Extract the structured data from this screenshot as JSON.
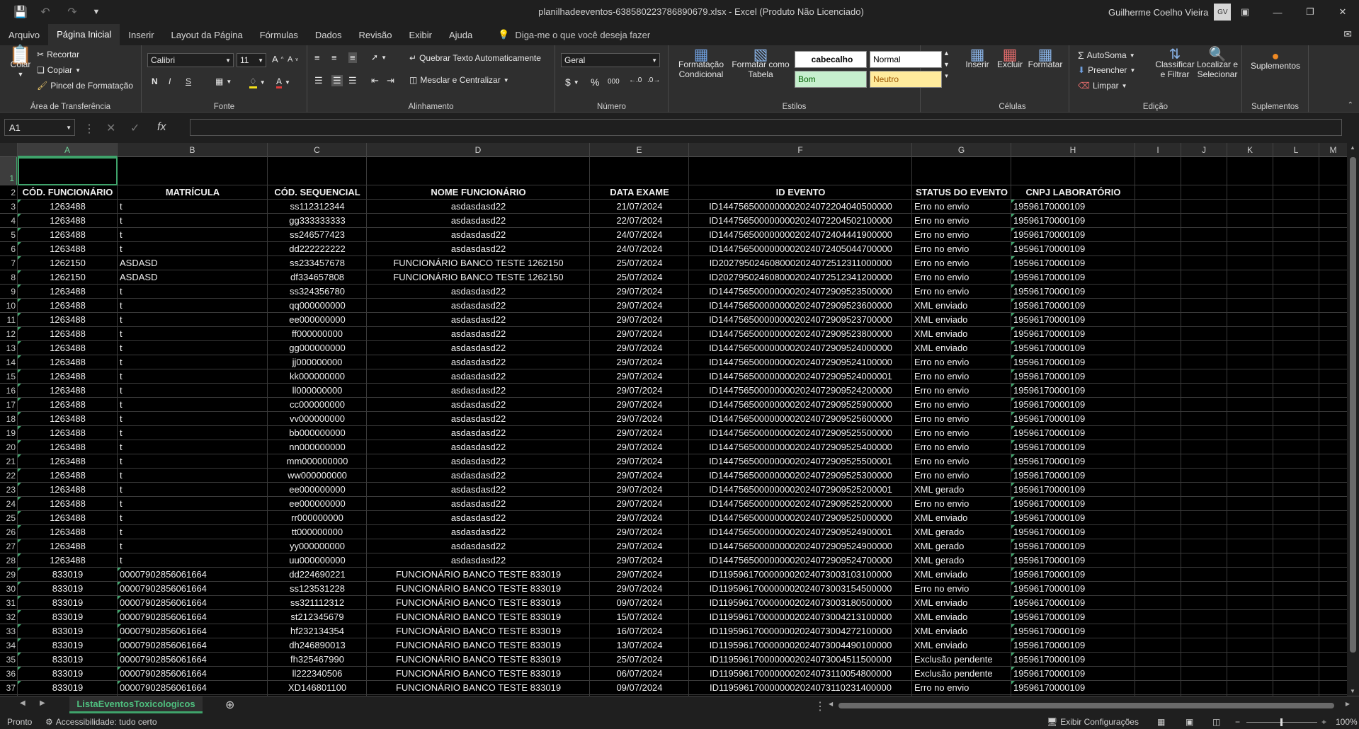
{
  "titlebar": {
    "title": "planilhadeeventos-638580223786890679.xlsx  -  Excel (Produto Não Licenciado)",
    "user_name": "Guilherme Coelho Vieira",
    "user_initials": "GV"
  },
  "menu": {
    "tabs": [
      "Arquivo",
      "Página Inicial",
      "Inserir",
      "Layout da Página",
      "Fórmulas",
      "Dados",
      "Revisão",
      "Exibir",
      "Ajuda"
    ],
    "tell_me": "Diga-me o que você deseja fazer"
  },
  "ribbon": {
    "clipboard": {
      "paste": "Colar",
      "cut": "Recortar",
      "copy": "Copiar",
      "format_painter": "Pincel de Formatação",
      "label": "Área de Transferência"
    },
    "font": {
      "name": "Calibri",
      "size": "11",
      "bold": "N",
      "italic": "I",
      "underline": "S",
      "label": "Fonte"
    },
    "alignment": {
      "wrap": "Quebrar Texto Automaticamente",
      "merge": "Mesclar e Centralizar",
      "label": "Alinhamento"
    },
    "number": {
      "format": "Geral",
      "currency": "$",
      "percent": "%",
      "thousands": "000",
      "label": "Número"
    },
    "styles": {
      "conditional": "Formatação Condicional",
      "as_table": "Formatar como Tabela",
      "style_cabecalho": "cabecalho",
      "style_normal": "Normal",
      "style_bom": "Bom",
      "style_neutro": "Neutro",
      "label": "Estilos"
    },
    "cells": {
      "insert": "Inserir",
      "delete": "Excluir",
      "format": "Formatar",
      "label": "Células"
    },
    "editing": {
      "autosum": "AutoSoma",
      "fill": "Preencher",
      "clear": "Limpar",
      "sort": "Classificar e Filtrar",
      "find": "Localizar e Selecionar",
      "label": "Edição"
    },
    "addins": {
      "addins": "Suplementos",
      "label": "Suplementos"
    }
  },
  "formula_bar": {
    "name_box": "A1",
    "fx": "fx",
    "content": ""
  },
  "grid": {
    "columns": [
      "A",
      "B",
      "C",
      "D",
      "E",
      "F",
      "G",
      "H",
      "I",
      "J",
      "K",
      "L",
      "M"
    ],
    "headers": [
      "CÓD. FUNCIONÁRIO",
      "MATRÍCULA",
      "CÓD. SEQUENCIAL",
      "NOME FUNCIONÁRIO",
      "DATA EXAME",
      "ID EVENTO",
      "STATUS DO EVENTO",
      "CNPJ LABORATÓRIO"
    ],
    "rows": [
      [
        "1263488",
        "t",
        "ss112312344",
        "asdasdasd22",
        "21/07/2024",
        "ID1447565000000002024072204040500000",
        "Erro no envio",
        "19596170000109"
      ],
      [
        "1263488",
        "t",
        "gg333333333",
        "asdasdasd22",
        "22/07/2024",
        "ID1447565000000002024072204502100000",
        "Erro no envio",
        "19596170000109"
      ],
      [
        "1263488",
        "t",
        "ss246577423",
        "asdasdasd22",
        "24/07/2024",
        "ID1447565000000002024072404441900000",
        "Erro no envio",
        "19596170000109"
      ],
      [
        "1263488",
        "t",
        "dd222222222",
        "asdasdasd22",
        "24/07/2024",
        "ID1447565000000002024072405044700000",
        "Erro no envio",
        "19596170000109"
      ],
      [
        "1262150",
        "ASDASD",
        "ss233457678",
        "FUNCIONÁRIO BANCO TESTE 1262150",
        "25/07/2024",
        "ID2027950246080002024072512311000000",
        "Erro no envio",
        "19596170000109"
      ],
      [
        "1262150",
        "ASDASD",
        "df334657808",
        "FUNCIONÁRIO BANCO TESTE 1262150",
        "25/07/2024",
        "ID2027950246080002024072512341200000",
        "Erro no envio",
        "19596170000109"
      ],
      [
        "1263488",
        "t",
        "ss324356780",
        "asdasdasd22",
        "29/07/2024",
        "ID1447565000000002024072909523500000",
        "Erro no envio",
        "19596170000109"
      ],
      [
        "1263488",
        "t",
        "qq000000000",
        "asdasdasd22",
        "29/07/2024",
        "ID1447565000000002024072909523600000",
        "XML enviado",
        "19596170000109"
      ],
      [
        "1263488",
        "t",
        "ee000000000",
        "asdasdasd22",
        "29/07/2024",
        "ID1447565000000002024072909523700000",
        "XML enviado",
        "19596170000109"
      ],
      [
        "1263488",
        "t",
        "ff000000000",
        "asdasdasd22",
        "29/07/2024",
        "ID1447565000000002024072909523800000",
        "XML enviado",
        "19596170000109"
      ],
      [
        "1263488",
        "t",
        "gg000000000",
        "asdasdasd22",
        "29/07/2024",
        "ID1447565000000002024072909524000000",
        "XML enviado",
        "19596170000109"
      ],
      [
        "1263488",
        "t",
        "jj000000000",
        "asdasdasd22",
        "29/07/2024",
        "ID1447565000000002024072909524100000",
        "Erro no envio",
        "19596170000109"
      ],
      [
        "1263488",
        "t",
        "kk000000000",
        "asdasdasd22",
        "29/07/2024",
        "ID1447565000000002024072909524000001",
        "Erro no envio",
        "19596170000109"
      ],
      [
        "1263488",
        "t",
        "ll000000000",
        "asdasdasd22",
        "29/07/2024",
        "ID1447565000000002024072909524200000",
        "Erro no envio",
        "19596170000109"
      ],
      [
        "1263488",
        "t",
        "cc000000000",
        "asdasdasd22",
        "29/07/2024",
        "ID1447565000000002024072909525900000",
        "Erro no envio",
        "19596170000109"
      ],
      [
        "1263488",
        "t",
        "vv000000000",
        "asdasdasd22",
        "29/07/2024",
        "ID1447565000000002024072909525600000",
        "Erro no envio",
        "19596170000109"
      ],
      [
        "1263488",
        "t",
        "bb000000000",
        "asdasdasd22",
        "29/07/2024",
        "ID1447565000000002024072909525500000",
        "Erro no envio",
        "19596170000109"
      ],
      [
        "1263488",
        "t",
        "nn000000000",
        "asdasdasd22",
        "29/07/2024",
        "ID1447565000000002024072909525400000",
        "Erro no envio",
        "19596170000109"
      ],
      [
        "1263488",
        "t",
        "mm000000000",
        "asdasdasd22",
        "29/07/2024",
        "ID1447565000000002024072909525500001",
        "Erro no envio",
        "19596170000109"
      ],
      [
        "1263488",
        "t",
        "ww000000000",
        "asdasdasd22",
        "29/07/2024",
        "ID1447565000000002024072909525300000",
        "Erro no envio",
        "19596170000109"
      ],
      [
        "1263488",
        "t",
        "ee000000000",
        "asdasdasd22",
        "29/07/2024",
        "ID1447565000000002024072909525200001",
        "XML gerado",
        "19596170000109"
      ],
      [
        "1263488",
        "t",
        "ee000000000",
        "asdasdasd22",
        "29/07/2024",
        "ID1447565000000002024072909525200000",
        "Erro no envio",
        "19596170000109"
      ],
      [
        "1263488",
        "t",
        "rr000000000",
        "asdasdasd22",
        "29/07/2024",
        "ID1447565000000002024072909525000000",
        "XML enviado",
        "19596170000109"
      ],
      [
        "1263488",
        "t",
        "tt000000000",
        "asdasdasd22",
        "29/07/2024",
        "ID1447565000000002024072909524900001",
        "XML gerado",
        "19596170000109"
      ],
      [
        "1263488",
        "t",
        "yy000000000",
        "asdasdasd22",
        "29/07/2024",
        "ID1447565000000002024072909524900000",
        "XML gerado",
        "19596170000109"
      ],
      [
        "1263488",
        "t",
        "uu000000000",
        "asdasdasd22",
        "29/07/2024",
        "ID1447565000000002024072909524700000",
        "XML gerado",
        "19596170000109"
      ],
      [
        "833019",
        "00007902856061664",
        "dd224690221",
        "FUNCIONÁRIO BANCO TESTE 833019",
        "29/07/2024",
        "ID1195961700000002024073003103100000",
        "XML enviado",
        "19596170000109"
      ],
      [
        "833019",
        "00007902856061664",
        "ss123531228",
        "FUNCIONÁRIO BANCO TESTE 833019",
        "29/07/2024",
        "ID1195961700000002024073003154500000",
        "Erro no envio",
        "19596170000109"
      ],
      [
        "833019",
        "00007902856061664",
        "ss321112312",
        "FUNCIONÁRIO BANCO TESTE 833019",
        "09/07/2024",
        "ID1195961700000002024073003180500000",
        "XML enviado",
        "19596170000109"
      ],
      [
        "833019",
        "00007902856061664",
        "st212345679",
        "FUNCIONÁRIO BANCO TESTE 833019",
        "15/07/2024",
        "ID1195961700000002024073004213100000",
        "XML enviado",
        "19596170000109"
      ],
      [
        "833019",
        "00007902856061664",
        "hf232134354",
        "FUNCIONÁRIO BANCO TESTE 833019",
        "16/07/2024",
        "ID1195961700000002024073004272100000",
        "XML enviado",
        "19596170000109"
      ],
      [
        "833019",
        "00007902856061664",
        "dh246890013",
        "FUNCIONÁRIO BANCO TESTE 833019",
        "13/07/2024",
        "ID1195961700000002024073004490100000",
        "XML enviado",
        "19596170000109"
      ],
      [
        "833019",
        "00007902856061664",
        "fh325467990",
        "FUNCIONÁRIO BANCO TESTE 833019",
        "25/07/2024",
        "ID1195961700000002024073004511500000",
        "Exclusão pendente",
        "19596170000109"
      ],
      [
        "833019",
        "00007902856061664",
        "ll222340506",
        "FUNCIONÁRIO BANCO TESTE 833019",
        "06/07/2024",
        "ID1195961700000002024073110054800000",
        "Exclusão pendente",
        "19596170000109"
      ],
      [
        "833019",
        "00007902856061664",
        "XD146801100",
        "FUNCIONÁRIO BANCO TESTE 833019",
        "09/07/2024",
        "ID1195961700000002024073110231400000",
        "Erro no envio",
        "19596170000109"
      ]
    ]
  },
  "sheets": {
    "active": "ListaEventosToxicologicos"
  },
  "statusbar": {
    "ready": "Pronto",
    "accessibility": "Accessibilidade: tudo certo",
    "display_settings": "Exibir Configurações",
    "zoom": "100%"
  },
  "colors": {
    "accent": "#3fa36b",
    "sheet_bg": "#000000",
    "ribbon_bg": "#2f2f2f"
  }
}
